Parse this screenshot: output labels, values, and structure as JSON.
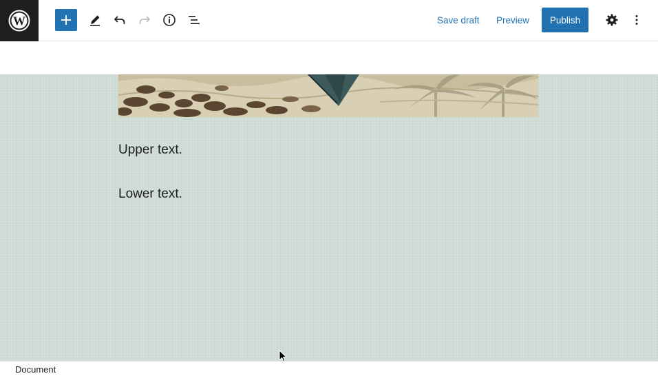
{
  "toolbar": {
    "inserter_icon": "plus-icon",
    "tools_icon": "pencil-icon",
    "undo_icon": "undo-icon",
    "redo_icon": "redo-icon",
    "info_icon": "info-icon",
    "list_view_icon": "list-view-icon",
    "save_draft_label": "Save draft",
    "preview_label": "Preview",
    "publish_label": "Publish",
    "settings_icon": "gear-icon",
    "options_icon": "more-vertical-icon"
  },
  "content": {
    "upper_text": "Upper text.",
    "lower_text": "Lower text."
  },
  "footer": {
    "breadcrumb": "Document"
  },
  "colors": {
    "accent": "#2271b1",
    "logo_background": "#1e1e1e",
    "canvas_background": "#cfdcd6"
  }
}
